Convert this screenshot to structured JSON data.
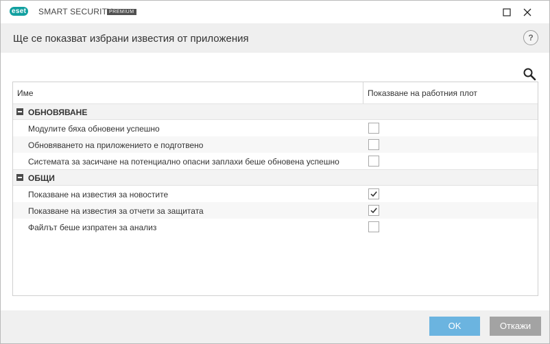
{
  "titlebar": {
    "logo_text": "eset",
    "product": "SMART SECURITY",
    "edition": "PREMIUM",
    "minimize_icon": "minimize-icon",
    "maximize_icon": "maximize-icon",
    "close_icon": "close-icon"
  },
  "header": {
    "title": "Ще се показват избрани известия от приложения",
    "help_label": "?"
  },
  "table": {
    "columns": [
      "Име",
      "Показване на работния плот"
    ],
    "groups": [
      {
        "label": "ОБНОВЯВАНЕ",
        "items": [
          {
            "label": "Модулите бяха обновени успешно",
            "checked": false
          },
          {
            "label": "Обновяването на приложението е подготвено",
            "checked": false
          },
          {
            "label": "Системата за засичане на потенциално опасни заплахи беше обновена успешно",
            "checked": false
          }
        ]
      },
      {
        "label": "ОБЩИ",
        "items": [
          {
            "label": "Показване на известия за новостите",
            "checked": true
          },
          {
            "label": "Показване на известия за отчети за защитата",
            "checked": true
          },
          {
            "label": "Файлът беше изпратен за анализ",
            "checked": false
          }
        ]
      }
    ]
  },
  "footer": {
    "ok_label": "OK",
    "cancel_label": "Откажи"
  },
  "colors": {
    "brand": "#12a0a0",
    "ok_button": "#6bb4e0",
    "cancel_button": "#a3a3a3"
  }
}
